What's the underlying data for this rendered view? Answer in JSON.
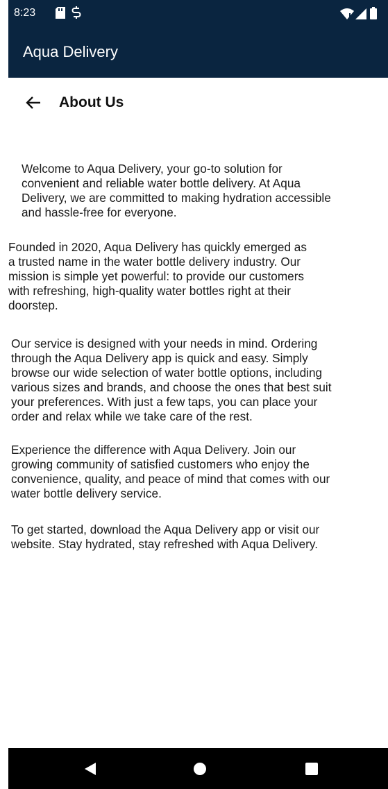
{
  "status_bar": {
    "time": "8:23",
    "icons": [
      "sd-card-icon",
      "sync-icon",
      "wifi-icon",
      "signal-icon",
      "battery-icon"
    ]
  },
  "app_bar": {
    "title": "Aqua Delivery",
    "background_color": "#0a2540"
  },
  "page": {
    "title": "About Us",
    "back_icon": "arrow-left-icon"
  },
  "content": {
    "paragraphs": [
      "Welcome to Aqua Delivery, your go-to solution for\nconvenient and reliable water bottle delivery. At Aqua\nDelivery, we are committed to making hydration accessible\nand hassle-free for everyone.",
      "Founded in 2020, Aqua Delivery has quickly emerged as\na trusted name in the water bottle delivery industry. Our\nmission is simple yet powerful: to provide our customers\nwith refreshing, high-quality water bottles right at their\ndoorstep.",
      "Our service is designed with your needs in mind. Ordering\nthrough the Aqua Delivery app is quick and easy. Simply\nbrowse our wide selection of water bottle options, including\nvarious sizes and brands, and choose the ones that best suit\nyour preferences. With just a few taps, you can place your\norder and relax while we take care of the rest.",
      "Experience the difference with Aqua Delivery. Join our\ngrowing community of satisfied customers who enjoy the\nconvenience, quality, and peace of mind that comes with our\nwater bottle delivery service.",
      "To get started, download the Aqua Delivery app or visit our\nwebsite. Stay hydrated, stay refreshed with Aqua Delivery."
    ]
  },
  "nav_bar": {
    "buttons": [
      "back-nav-icon",
      "home-nav-icon",
      "recents-nav-icon"
    ]
  }
}
